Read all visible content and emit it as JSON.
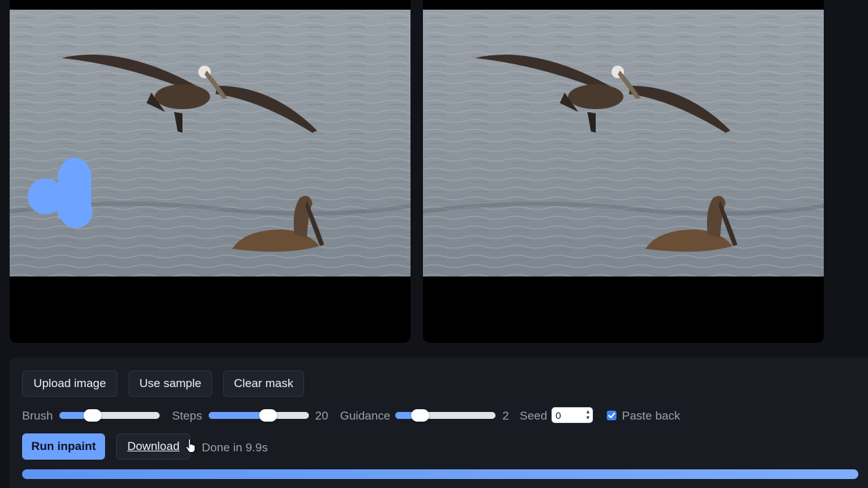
{
  "panels": {
    "input": {
      "has_mask": true
    },
    "output": {
      "has_mask": false
    }
  },
  "toolbar": {
    "upload_label": "Upload image",
    "sample_label": "Use sample",
    "clear_label": "Clear mask",
    "run_label": "Run inpaint",
    "download_label": "Download"
  },
  "params": {
    "brush": {
      "label": "Brush",
      "fraction": 0.33
    },
    "steps": {
      "label": "Steps",
      "value": "20",
      "fraction": 0.59
    },
    "guidance": {
      "label": "Guidance",
      "value": "2",
      "fraction": 0.25
    },
    "seed": {
      "label": "Seed",
      "value": "0"
    },
    "paste_back": {
      "label": "Paste back",
      "checked": true
    }
  },
  "status": {
    "text": "Done in 9.9s",
    "progress": 1.0
  },
  "colors": {
    "accent": "#6ca0ff",
    "mask": "#6ea4ff",
    "background": "#111318",
    "panel": "#181b22"
  }
}
